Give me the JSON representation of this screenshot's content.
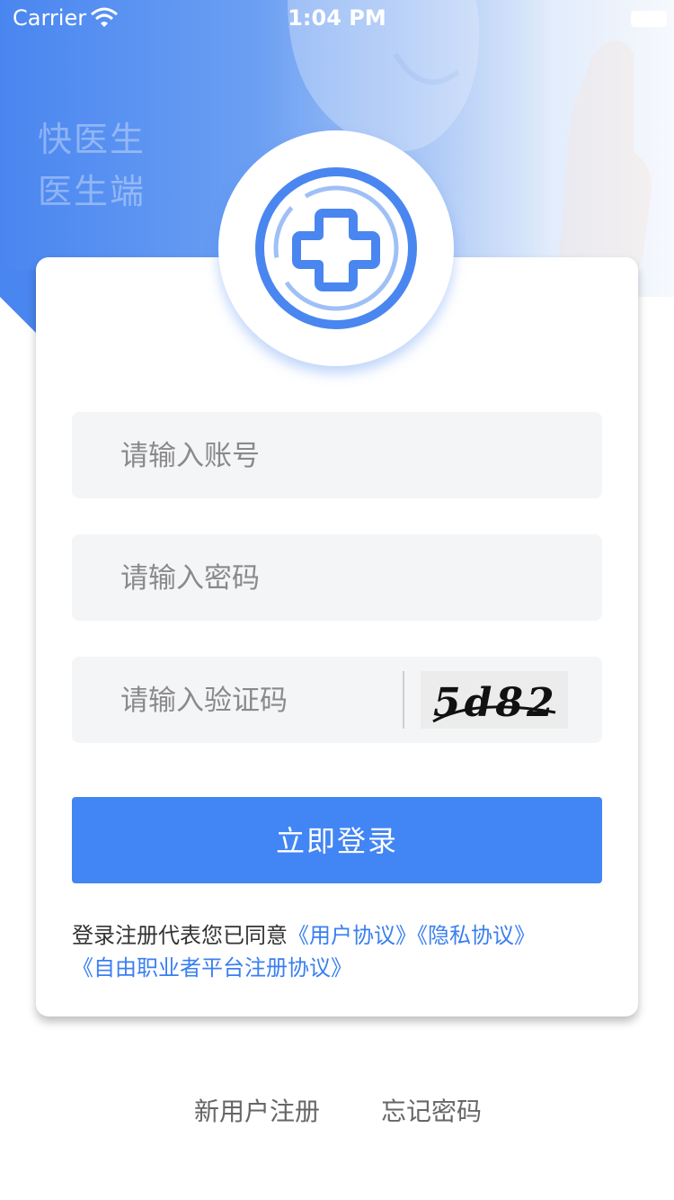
{
  "status_bar": {
    "carrier": "Carrier",
    "time": "1:04 PM"
  },
  "brand": {
    "line1": "快医生",
    "line2": "医生端"
  },
  "form": {
    "account_placeholder": "请输入账号",
    "password_placeholder": "请输入密码",
    "captcha_placeholder": "请输入验证码",
    "captcha_text": "5d82",
    "login_label": "立即登录"
  },
  "agreement": {
    "prefix": "登录注册代表您已同意",
    "user_agreement": "《用户协议》",
    "privacy_agreement": "《隐私协议》",
    "platform_agreement": "《自由职业者平台注册协议》"
  },
  "bottom": {
    "register": "新用户注册",
    "forgot": "忘记密码"
  },
  "colors": {
    "primary": "#4285f4",
    "link": "#3a7ff0",
    "field_bg": "#f4f5f7"
  },
  "icons": {
    "logo": "medical-cross-icon",
    "wifi": "wifi-icon",
    "battery": "battery-icon"
  }
}
